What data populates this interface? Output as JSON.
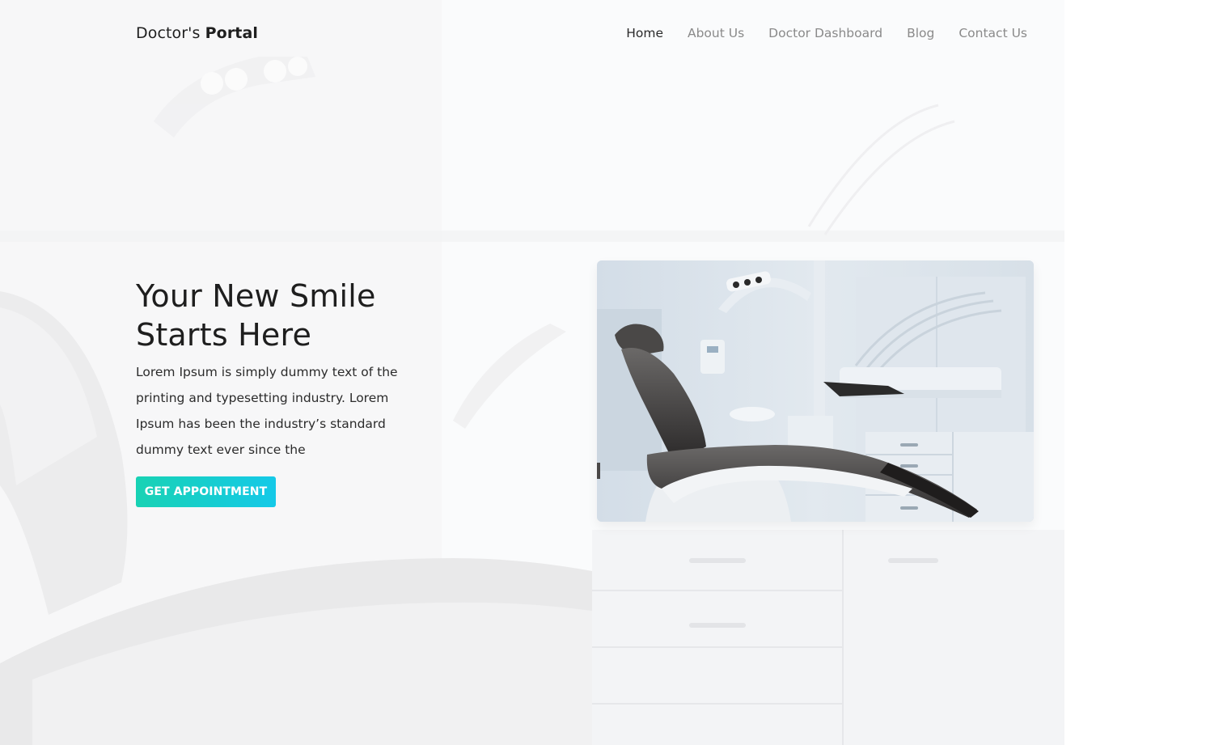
{
  "header": {
    "logo_light": "Doctor's",
    "logo_bold": "Portal",
    "nav": [
      {
        "label": "Home",
        "active": true
      },
      {
        "label": "About Us",
        "active": false
      },
      {
        "label": "Doctor Dashboard",
        "active": false
      },
      {
        "label": "Blog",
        "active": false
      },
      {
        "label": "Contact Us",
        "active": false
      }
    ]
  },
  "hero": {
    "title": "Your New Smile Starts Here",
    "description": "Lorem Ipsum is simply dummy text of the printing and typesetting industry. Lorem Ipsum has been the industry’s standard dummy text ever since the",
    "cta_label": "GET APPOINTMENT",
    "image_subject": "dental-chair-photo"
  },
  "colors": {
    "accent_start": "#18d2b4",
    "accent_end": "#15c9e8",
    "text": "#1e1e1e",
    "nav_inactive": "#8a8a8a"
  }
}
